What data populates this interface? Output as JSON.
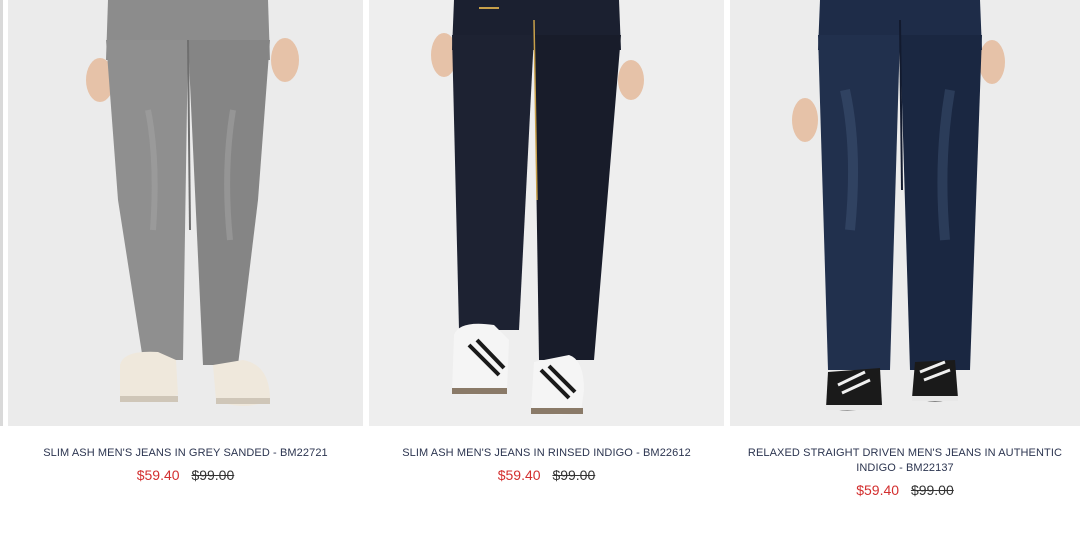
{
  "products": [
    {
      "title": "SLIM ASH MEN'S JEANS IN GREY SANDED - BM22721",
      "sale_price": "$59.40",
      "original_price": "$99.00",
      "colors": {
        "denim": "#8c8c8c",
        "denim_dark": "#6f6f6f",
        "shoe": "#efe8dc",
        "bg": "#ebebeb"
      }
    },
    {
      "title": "SLIM ASH MEN'S JEANS IN RINSED INDIGO - BM22612",
      "sale_price": "$59.40",
      "original_price": "$99.00",
      "colors": {
        "denim": "#1b2030",
        "denim_dark": "#11141f",
        "shoe": "#f5f5f5",
        "bg": "#eeeeee"
      }
    },
    {
      "title": "RELAXED STRAIGHT DRIVEN MEN'S JEANS IN AUTHENTIC INDIGO - BM22137",
      "sale_price": "$59.40",
      "original_price": "$99.00",
      "colors": {
        "denim": "#1e2c48",
        "denim_dark": "#141d33",
        "shoe": "#1a1a1a",
        "bg": "#ececec"
      }
    }
  ],
  "theme": {
    "title_color": "#2c3550",
    "sale_color": "#d32f2f"
  }
}
